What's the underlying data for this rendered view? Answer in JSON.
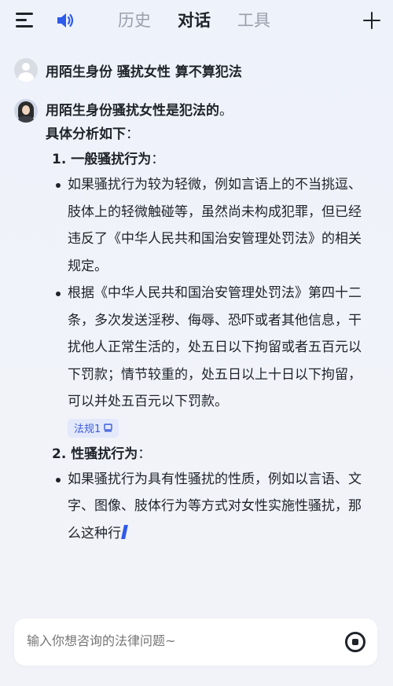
{
  "header": {
    "tabs": [
      {
        "label": "历史",
        "active": false
      },
      {
        "label": "对话",
        "active": true
      },
      {
        "label": "工具",
        "active": false
      }
    ]
  },
  "user_message": {
    "text": "用陌生身份 骚扰女性 算不算犯法"
  },
  "ai_message": {
    "lead": "用陌生身份骚扰女性是犯法的",
    "lead_end": "。",
    "sub_heading": "具体分析如下",
    "sections": [
      {
        "number": "1.",
        "title": "一般骚扰行为",
        "bullets": [
          "如果骚扰行为较为轻微，例如言语上的不当挑逗、肢体上的轻微触碰等，虽然尚未构成犯罪，但已经违反了《中华人民共和国治安管理处罚法》的相关规定。",
          "根据《中华人民共和国治安管理处罚法》第四十二条，多次发送淫秽、侮辱、恐吓或者其他信息，干扰他人正常生活的，处五日以下拘留或者五百元以下罚款；情节较重的，处五日以上十日以下拘留，可以并处五百元以下罚款。"
        ],
        "tag": "法规1"
      },
      {
        "number": "2.",
        "title": "性骚扰行为",
        "bullets": [
          "如果骚扰行为具有性骚扰的性质，例如以言语、文字、图像、肢体行为等方式对女性实施性骚扰，那么这种行"
        ]
      }
    ],
    "colon": "："
  },
  "input": {
    "placeholder": "输入你想咨询的法律问题~"
  },
  "colors": {
    "accent": "#2f5bea",
    "tag_bg": "#e3e9fb",
    "tag_text": "#3b5bdb"
  }
}
